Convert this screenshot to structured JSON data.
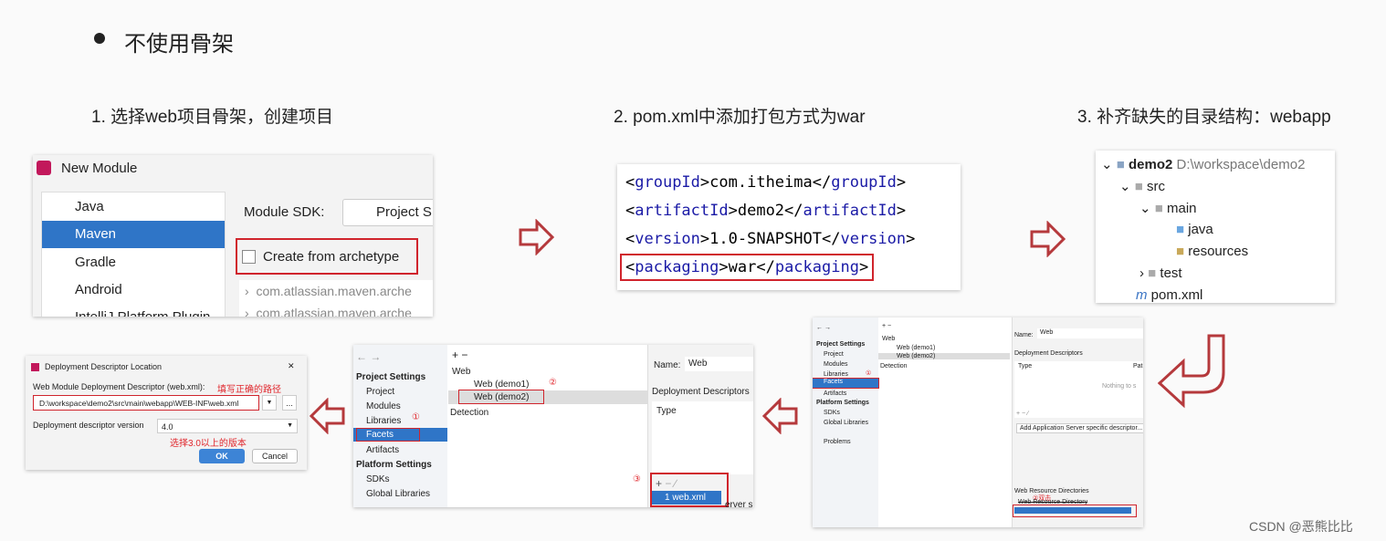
{
  "bullet": "不使用骨架",
  "steps": [
    "1. 选择web项目骨架，创建项目",
    "2. pom.xml中添加打包方式为war",
    "3. 补齐缺失的目录结构：webapp"
  ],
  "new_module": {
    "title": "New Module",
    "items": [
      "Java",
      "Maven",
      "Gradle",
      "Android",
      "IntelliJ Platform Plugin"
    ],
    "selected": "Maven",
    "sdk_label": "Module SDK:",
    "sdk_value": "Project S",
    "archetype_label": "Create from archetype",
    "archetype_checked": false,
    "archetypes": [
      "com.atlassian.maven.arche",
      "com.atlassian.maven.arche"
    ]
  },
  "pom": {
    "lines": [
      [
        "groupId",
        "com.itheima"
      ],
      [
        "artifactId",
        "demo2"
      ],
      [
        "version",
        "1.0-SNAPSHOT"
      ],
      [
        "packaging",
        "war"
      ]
    ]
  },
  "tree": {
    "root": "demo2",
    "root_path": "D:\\workspace\\demo2",
    "items": [
      "src",
      "main",
      "java",
      "resources",
      "test",
      "pom.xml"
    ]
  },
  "ps_large": {
    "nav": [
      "←",
      "→"
    ],
    "project_settings": "Project Settings",
    "ps_items": [
      "Project",
      "Modules",
      "Libraries",
      "Facets",
      "Artifacts"
    ],
    "platform_settings": "Platform Settings",
    "pl_items": [
      "SDKs",
      "Global Libraries"
    ],
    "problems": "Problems",
    "web": "Web",
    "facets": [
      "Web (demo1)",
      "Web (demo2)"
    ],
    "detection": "Detection",
    "name_label": "Name:",
    "name_value": "Web",
    "dd": "Deployment Descriptors",
    "type": "Type",
    "path": "Pat",
    "nothing": "Nothing to s",
    "add_server": "Add Application Server specific descriptor...",
    "wrd": "Web Resource Directories",
    "wrd_col": "Web Resource Directory",
    "mark1": "①",
    "mark2": "②双击"
  },
  "ps_mid": {
    "marks": [
      "①",
      "②",
      "③"
    ],
    "webxml": "1  web.xml",
    "server": "erver s"
  },
  "dlg": {
    "title": "Deployment Descriptor Location",
    "label": "Web Module Deployment Descriptor (web.xml):",
    "hint1": "填写正确的路径",
    "path": "D:\\workspace\\demo2\\src\\main\\webapp\\WEB-INF\\web.xml",
    "browse": "...",
    "version_label": "Deployment descriptor version",
    "version": "4.0",
    "hint2": "选择3.0以上的版本",
    "ok": "OK",
    "cancel": "Cancel",
    "close": "✕"
  },
  "watermark": "CSDN @恶熊比比",
  "colors": {
    "accent": "#2f75c7",
    "highlight": "#d0242c",
    "arrow": "#b5393c"
  }
}
